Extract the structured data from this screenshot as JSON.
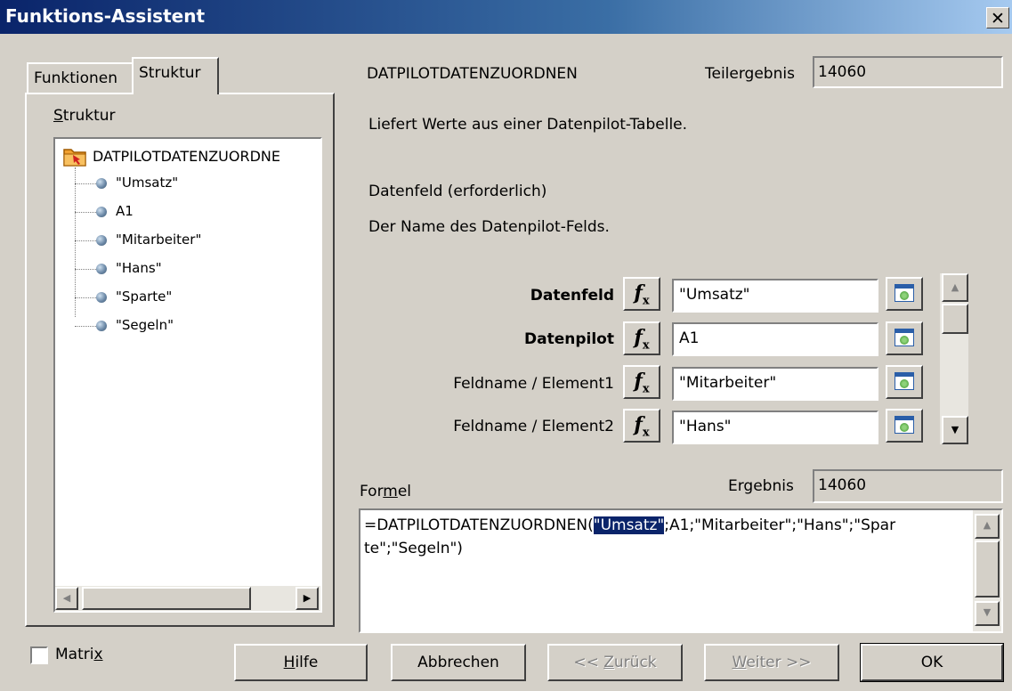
{
  "window": {
    "title": "Funktions-Assistent",
    "close_glyph": "✕"
  },
  "tabs": [
    {
      "label": "Funktionen"
    },
    {
      "label": "Struktur"
    }
  ],
  "structure": {
    "heading_pre": "",
    "heading_ul": "S",
    "heading_post": "truktur",
    "root": "DATPILOTDATENZUORDNE",
    "items": [
      "\"Umsatz\"",
      "A1",
      "\"Mitarbeiter\"",
      "\"Hans\"",
      "\"Sparte\"",
      "\"Segeln\""
    ]
  },
  "function": {
    "name": "DATPILOTDATENZUORDNEN",
    "partial_label": "Teilergebnis",
    "partial_value": "14060",
    "description": "Liefert Werte aus einer Datenpilot-Tabelle.",
    "param_title": "Datenfeld (erforderlich)",
    "param_desc": "Der Name des Datenpilot-Felds."
  },
  "args": [
    {
      "label": "Datenfeld",
      "value": "\"Umsatz\""
    },
    {
      "label": "Datenpilot",
      "value": "A1"
    },
    {
      "label": "Feldname / Element1",
      "value": "\"Mitarbeiter\""
    },
    {
      "label": "Feldname / Element2",
      "value": "\"Hans\""
    }
  ],
  "fx_label": "f",
  "fx_sub": "x",
  "formula": {
    "label_pre": "For",
    "label_ul": "m",
    "label_post": "el",
    "result_label": "Ergebnis",
    "result_value": "14060",
    "text_pre": "=DATPILOTDATENZUORDNEN(",
    "text_sel": "\"Umsatz\"",
    "text_post": ";A1;\"Mitarbeiter\";\"Hans\";\"Spar",
    "text_line2": "te\";\"Segeln\")"
  },
  "matrix": {
    "pre": "Matri",
    "ul": "x"
  },
  "buttons": {
    "help": {
      "ul": "H",
      "post": "ilfe"
    },
    "cancel": "Abbrechen",
    "back": {
      "pre": "<< ",
      "ul": "Z",
      "post": "urück"
    },
    "next": {
      "ul": "W",
      "post": "eiter >>"
    },
    "ok": "OK"
  }
}
